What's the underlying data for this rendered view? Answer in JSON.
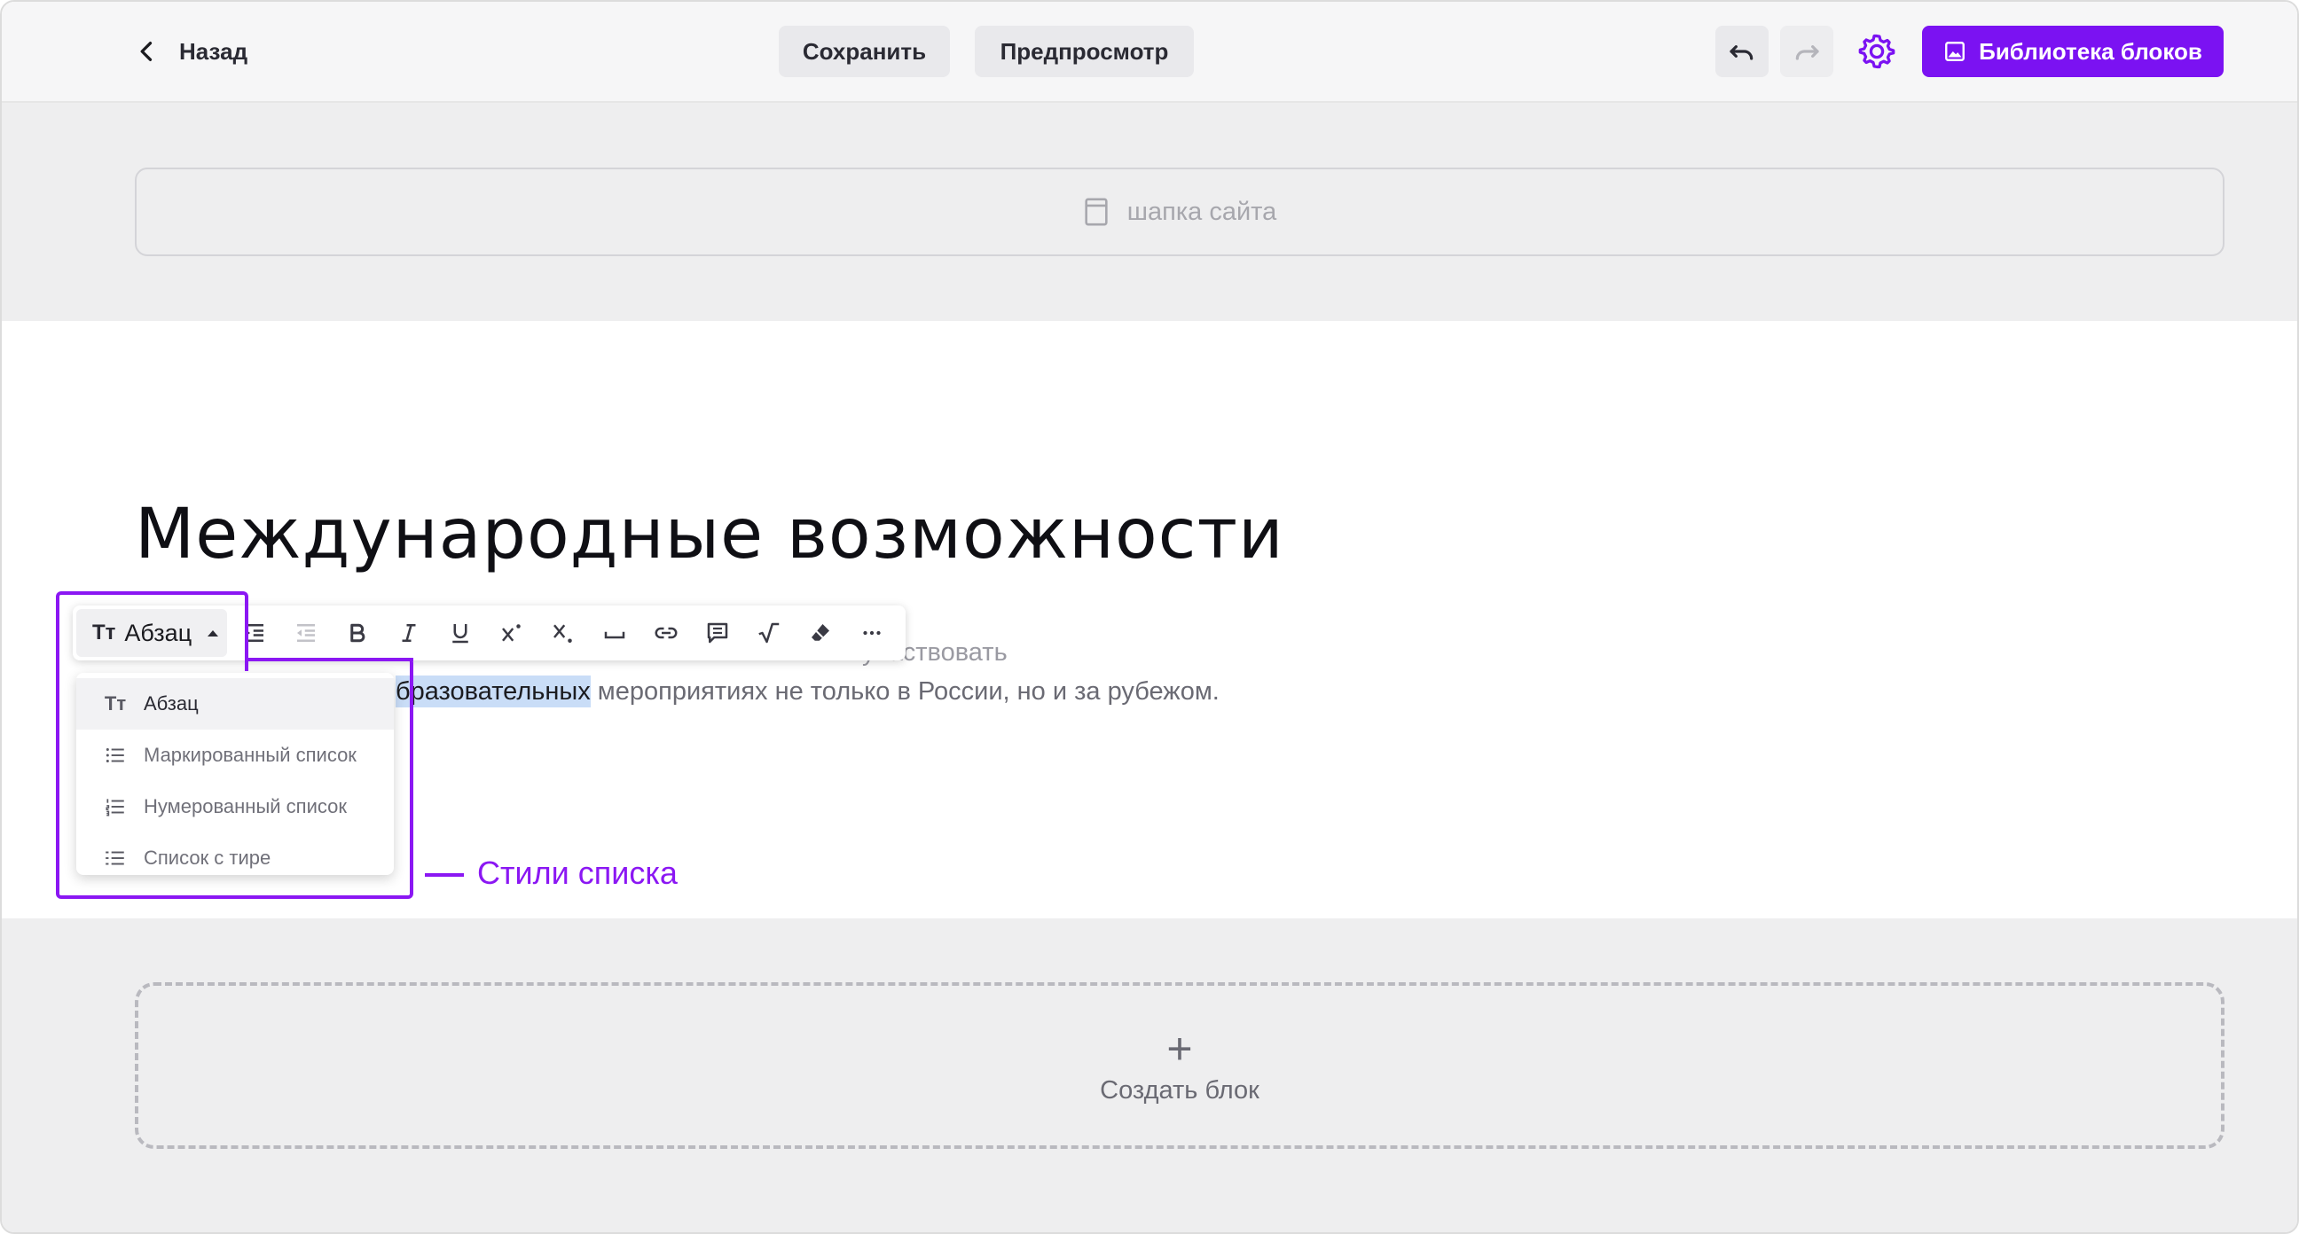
{
  "topbar": {
    "back_label": "Назад",
    "save_label": "Сохранить",
    "preview_label": "Предпросмотр",
    "library_label": "Библиотека блоков",
    "icons": [
      "chevron-left-icon",
      "undo-icon",
      "redo-icon",
      "gear-icon",
      "image-icon"
    ]
  },
  "header_block": {
    "label": "шапка сайта",
    "icon": "page-icon"
  },
  "content": {
    "title": "Международные возможности",
    "paragraph_line1_visible": "участвовать",
    "paragraph_line2_highlight": "бразовательных",
    "paragraph_line2_rest": " мероприятиях не только в России, но и за рубежом."
  },
  "toolbar": {
    "style_icon_text": "Тт",
    "style_label": "Абзац",
    "tools": [
      "indent-icon",
      "outdent-icon",
      "bold-icon",
      "italic-icon",
      "underline-icon",
      "superscript-icon",
      "subscript-icon",
      "space-icon",
      "link-icon",
      "comment-icon",
      "formula-icon",
      "eraser-icon",
      "more-icon"
    ]
  },
  "dropdown": {
    "items": [
      {
        "label": "Абзац",
        "icon": "text-icon",
        "icon_text": "Тт",
        "active": true
      },
      {
        "label": "Маркированный список",
        "icon": "bullet-list-icon",
        "active": false
      },
      {
        "label": "Нумерованный список",
        "icon": "numbered-list-icon",
        "active": false
      },
      {
        "label": "Список с тире",
        "icon": "dash-list-icon",
        "active": false
      }
    ]
  },
  "annotation": {
    "label": "Стили списка"
  },
  "create_block": {
    "plus": "+",
    "label": "Создать блок"
  },
  "colors": {
    "accent": "#7b12f2",
    "annotation": "#8b17f3",
    "highlight": "#c9ddf7"
  }
}
